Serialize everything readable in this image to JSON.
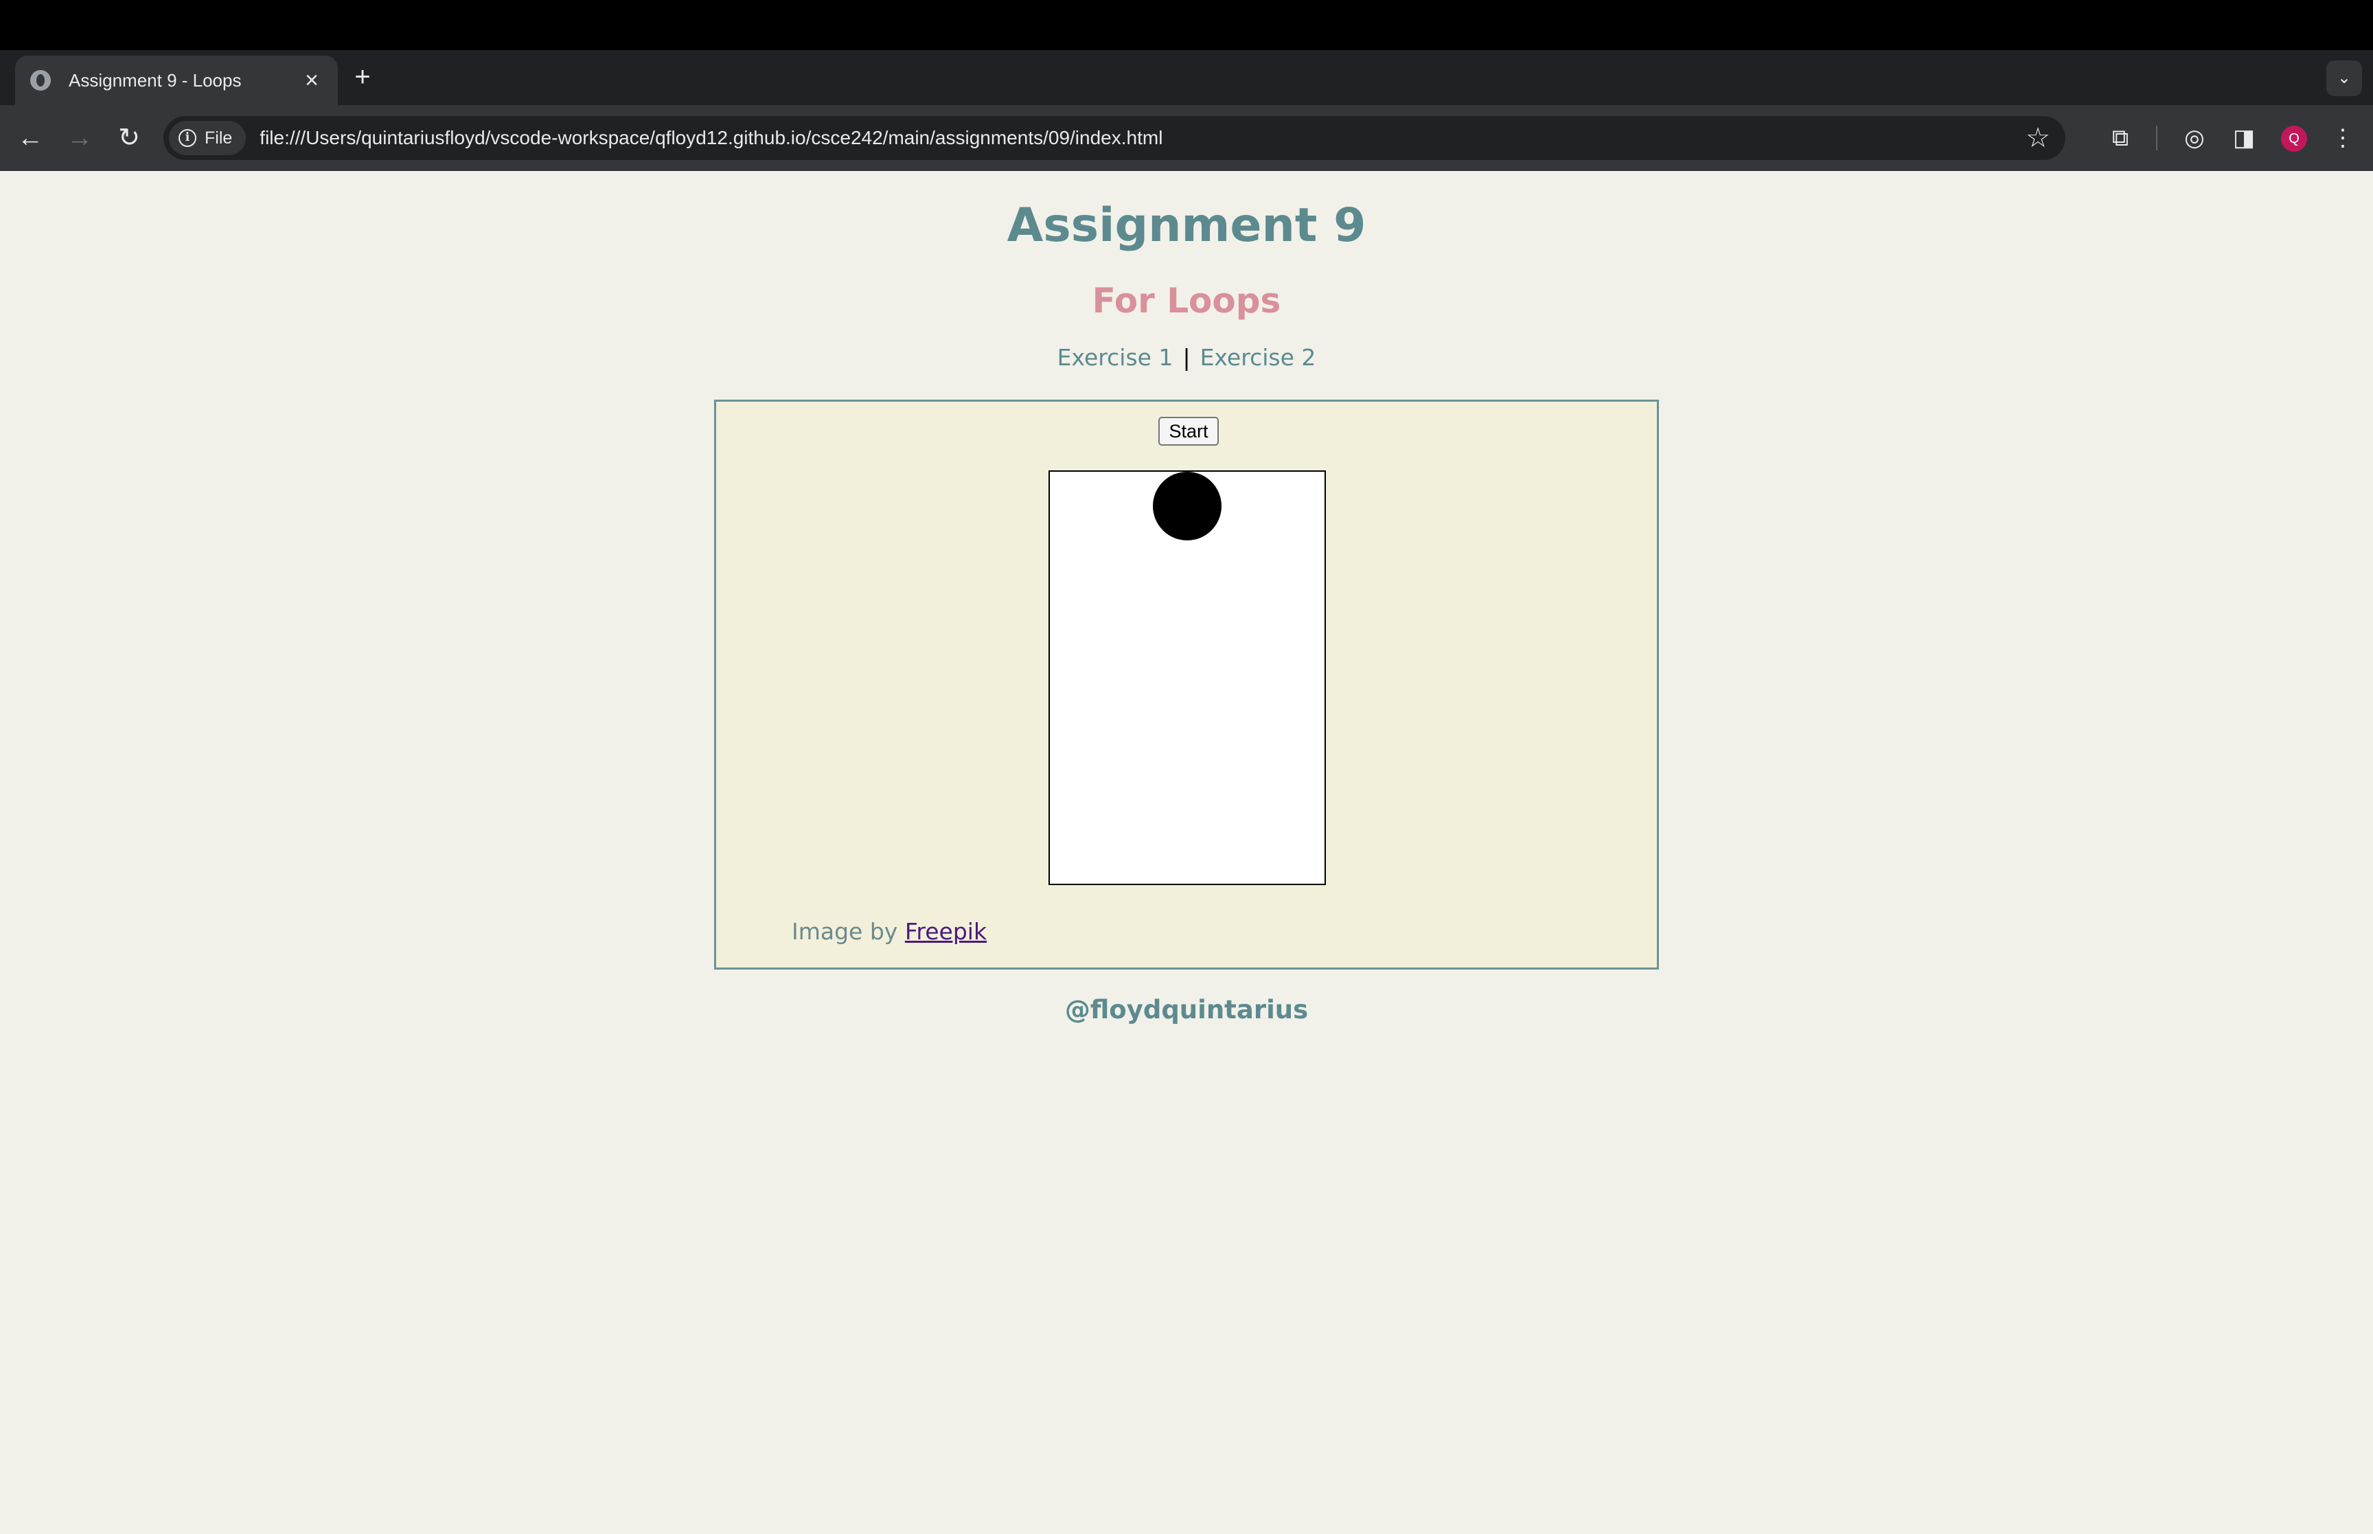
{
  "browser": {
    "tab": {
      "title": "Assignment 9 - Loops",
      "favicon": "globe-icon"
    },
    "new_tab_label": "+",
    "tab_search_icon": "chevron-down-icon",
    "nav": {
      "back_icon": "←",
      "forward_icon": "→",
      "reload_icon": "↻"
    },
    "omnibox": {
      "chip_label": "File",
      "url": "file:///Users/quintariusfloyd/vscode-workspace/qfloyd12.github.io/csce242/main/assignments/09/index.html"
    },
    "profile_initial": "Q",
    "accent_color": "#c2185b"
  },
  "page": {
    "title": "Assignment 9",
    "subtitle": "For Loops",
    "nav": {
      "exercise1": "Exercise 1",
      "separator": "|",
      "exercise2": "Exercise 2"
    },
    "start_button": "Start",
    "credit_prefix": "Image by",
    "credit_link": "Freepik",
    "footer": "@floydquintarius",
    "colors": {
      "background": "#f1f1e9",
      "heading": "#5c8a8f",
      "subtitle": "#d9909a",
      "panel": "#f2f0da"
    }
  }
}
